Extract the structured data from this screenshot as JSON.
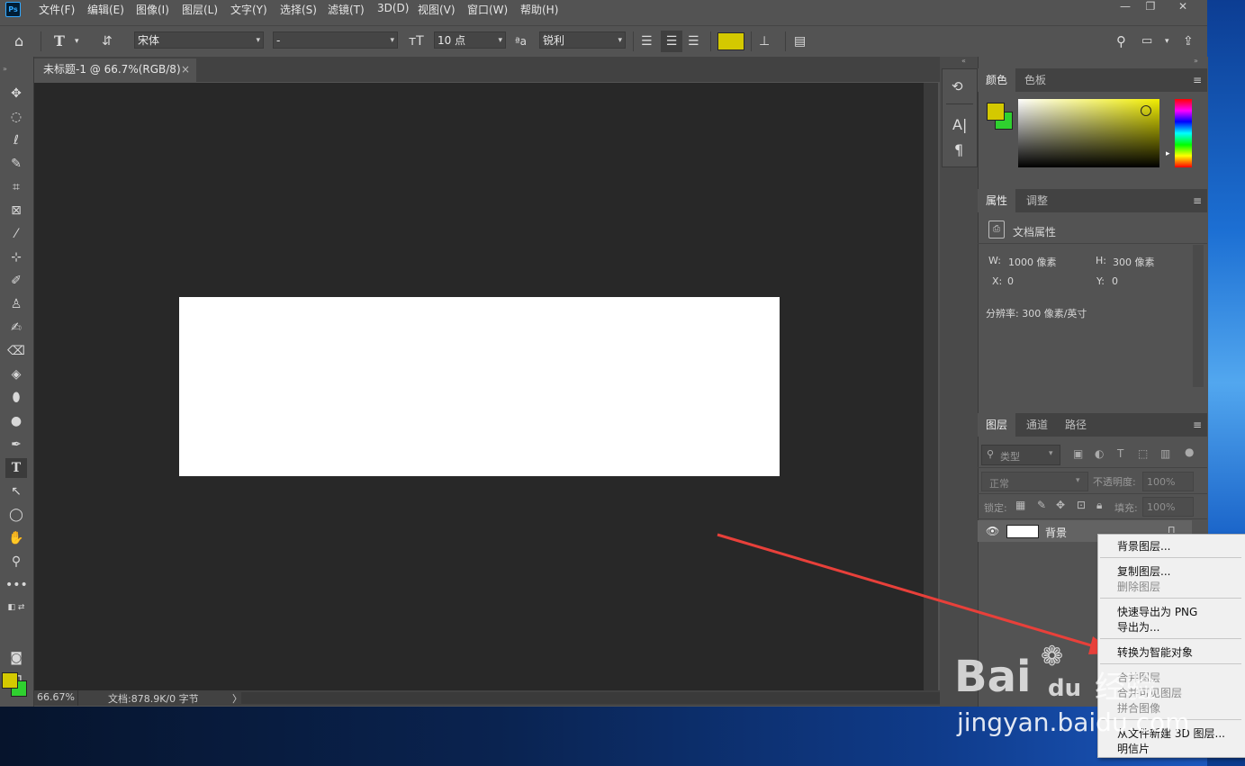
{
  "app": {
    "logo": "Ps",
    "accent": "#31a8ff"
  },
  "menu": [
    "文件(F)",
    "编辑(E)",
    "图像(I)",
    "图层(L)",
    "文字(Y)",
    "选择(S)",
    "滤镜(T)",
    "3D(D)",
    "视图(V)",
    "窗口(W)",
    "帮助(H)"
  ],
  "window_controls": {
    "minimize": "—",
    "restore": "❐",
    "close": "✕"
  },
  "options": {
    "font_family": "宋体",
    "font_style": "-",
    "font_size": "10 点",
    "antialias": "锐利",
    "text_color": "#d4c900"
  },
  "document": {
    "tab_title": "未标题-1 @ 66.7%(RGB/8)",
    "tab_close": "×",
    "zoom": "66.67%",
    "doc_info": "文档:878.9K/0 字节",
    "status_arrow": "〉"
  },
  "colors": {
    "foreground": "#d4c900",
    "background": "#2fd12f"
  },
  "color_panel": {
    "tabs": [
      "颜色",
      "色板"
    ],
    "menu_icon": "≡"
  },
  "properties_panel": {
    "tabs": [
      "属性",
      "调整"
    ],
    "header": "文档属性",
    "w_label": "W:",
    "w_value": "1000 像素",
    "h_label": "H:",
    "h_value": "300 像素",
    "x_label": "X:",
    "x_value": "0",
    "y_label": "Y:",
    "y_value": "0",
    "resolution": "分辨率: 300 像素/英寸"
  },
  "layers_panel": {
    "tabs": [
      "图层",
      "通道",
      "路径"
    ],
    "filter_kind": "类型",
    "blend_mode": "正常",
    "opacity_label": "不透明度:",
    "opacity_value": "100%",
    "lock_label": "锁定:",
    "fill_label": "填充:",
    "fill_value": "100%",
    "layer_name": "背景"
  },
  "context_menu": {
    "items": [
      {
        "label": "背景图层...",
        "enabled": true
      },
      {
        "label": "复制图层...",
        "enabled": true
      },
      {
        "label": "删除图层",
        "enabled": false
      },
      {
        "label": "快速导出为 PNG",
        "enabled": true
      },
      {
        "label": "导出为...",
        "enabled": true
      },
      {
        "label": "转换为智能对象",
        "enabled": true
      },
      {
        "label": "合并图层",
        "enabled": false
      },
      {
        "label": "合并可见图层",
        "enabled": false
      },
      {
        "label": "拼合图像",
        "enabled": false
      },
      {
        "label": "从文件新建 3D 图层...",
        "enabled": true
      },
      {
        "label": "明信片",
        "enabled": true
      }
    ]
  },
  "watermark": {
    "brand": "Bai",
    "brand2": "du",
    "sub": "经验",
    "url": "jingyan.baidu.com"
  },
  "annotation_color": "#e8403a"
}
